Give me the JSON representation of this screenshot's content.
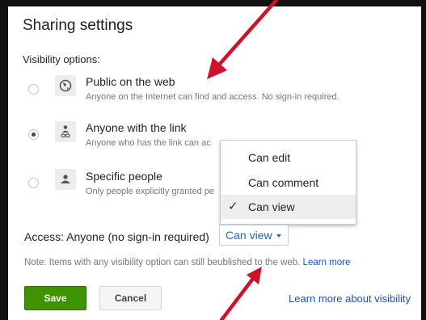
{
  "dialog": {
    "title": "Sharing settings",
    "visibility_label": "Visibility options:"
  },
  "options": [
    {
      "title": "Public on the web",
      "description": "Anyone on the Internet can find and access. No sign-in required.",
      "icon": "globe-icon",
      "selected": false
    },
    {
      "title": "Anyone with the link",
      "description": "Anyone who has the link can ac",
      "icon": "link-person-icon",
      "selected": true
    },
    {
      "title": "Specific people",
      "description": "Only people explicitly granted pe",
      "icon": "person-icon",
      "selected": false
    }
  ],
  "menu": {
    "items": [
      {
        "label": "Can edit",
        "checked": false
      },
      {
        "label": "Can comment",
        "checked": false
      },
      {
        "label": "Can view",
        "checked": true
      }
    ]
  },
  "access": {
    "label": "Access:  Anyone (no sign-in required)",
    "value": "Can view"
  },
  "note": {
    "text_before": "Note: Items with any visibility option can still be",
    "text_after": "ublished to the web.",
    "link": "Learn more"
  },
  "buttons": {
    "save": "Save",
    "cancel": "Cancel"
  },
  "learn_more_visibility": "Learn more about visibility",
  "colors": {
    "save_button": "#3d9400",
    "link": "#1155cc",
    "arrow": "#d0112b"
  }
}
